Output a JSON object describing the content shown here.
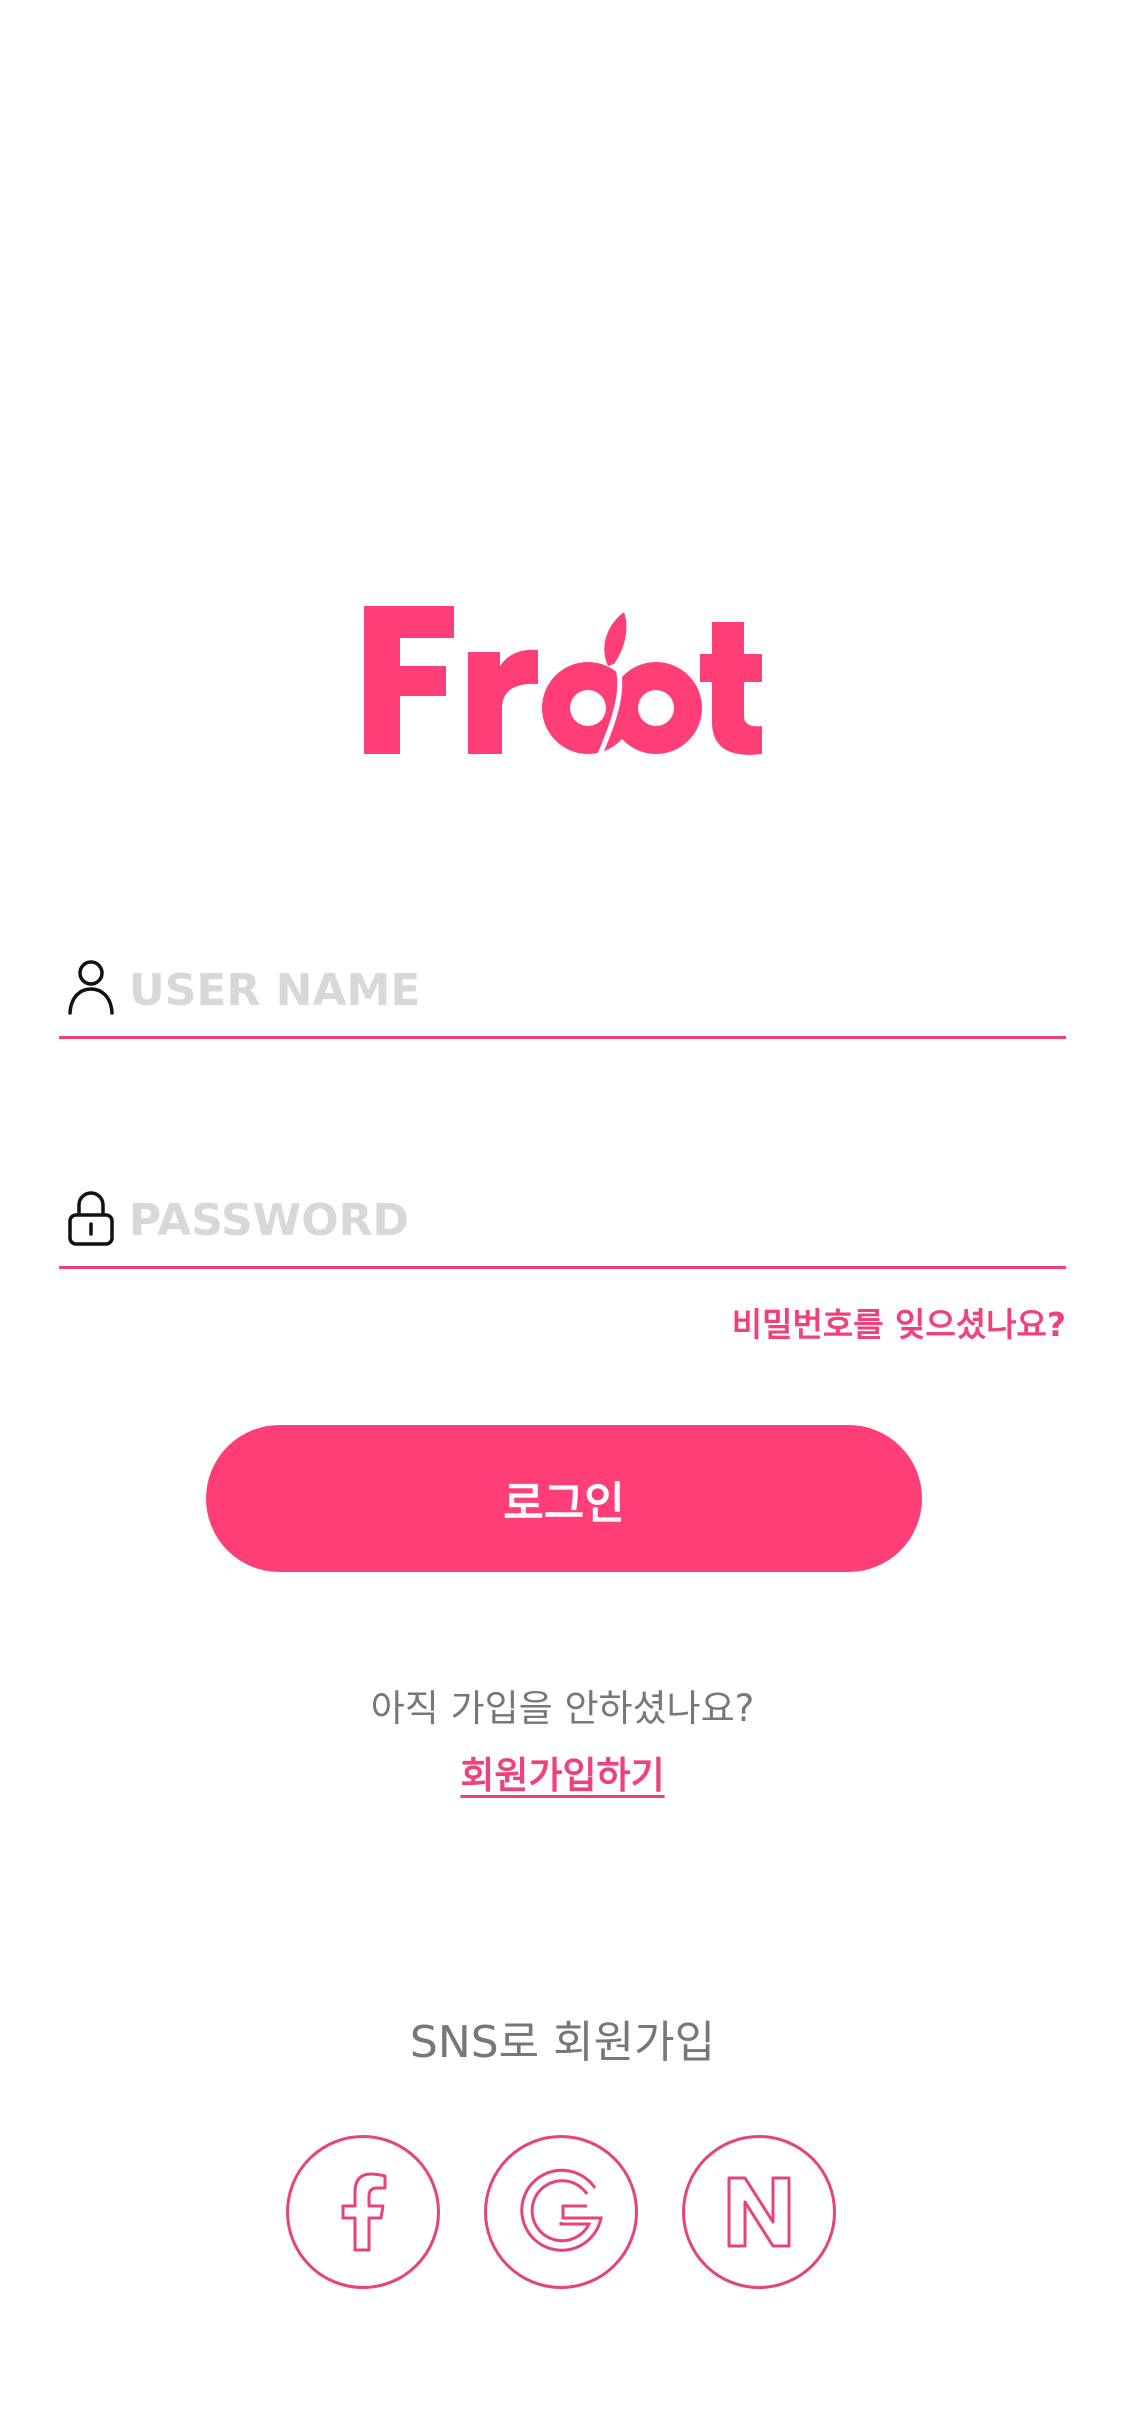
{
  "app": {
    "logo_text": "Froot",
    "brand_color": "#ff3d77",
    "line_color": "#f0427a"
  },
  "login": {
    "username_placeholder": "USER NAME",
    "password_placeholder": "PASSWORD",
    "forgot_label": "비밀번호를 잊으셨나요?",
    "login_label": "로그인"
  },
  "signup": {
    "question": "아직 가입을 안하셨나요?",
    "link_label": "회원가입하기"
  },
  "sns": {
    "title": "SNS로 회원가입",
    "providers": [
      {
        "name": "facebook",
        "icon": "facebook-icon"
      },
      {
        "name": "google",
        "icon": "google-icon"
      },
      {
        "name": "naver",
        "icon": "naver-icon"
      }
    ]
  }
}
